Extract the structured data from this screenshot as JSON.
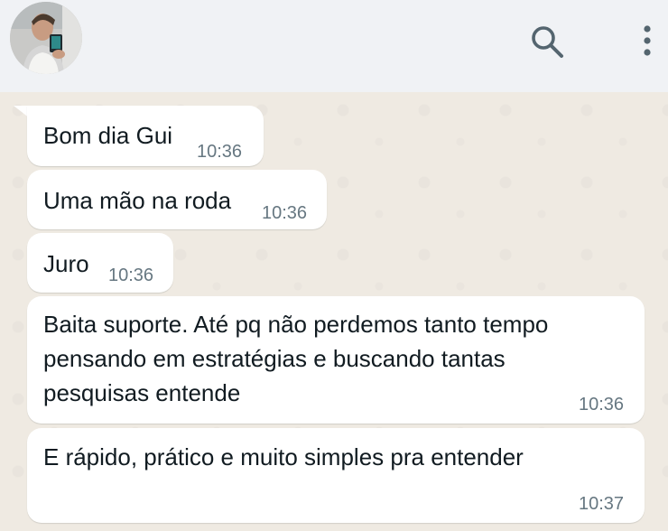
{
  "header": {
    "avatar_icon": "contact-avatar-photo",
    "search_icon": "search-icon",
    "menu_icon": "more-vertical-icon"
  },
  "messages": [
    {
      "text": "Bom dia Gui",
      "time": "10:36"
    },
    {
      "text": "Uma mão na roda",
      "time": "10:36"
    },
    {
      "text": "Juro",
      "time": "10:36"
    },
    {
      "text": "Baita suporte. Até pq não perdemos tanto tempo\npensando em estratégias e buscando tantas\npesquisas entende",
      "time": "10:36"
    },
    {
      "text": "E rápido, prático e muito simples pra entender",
      "time": "10:37"
    }
  ],
  "colors": {
    "header_bg": "#f0f2f5",
    "chat_bg": "#efeae2",
    "bubble_bg": "#ffffff",
    "text": "#111b21",
    "timestamp": "#667781",
    "icon": "#54656f"
  }
}
